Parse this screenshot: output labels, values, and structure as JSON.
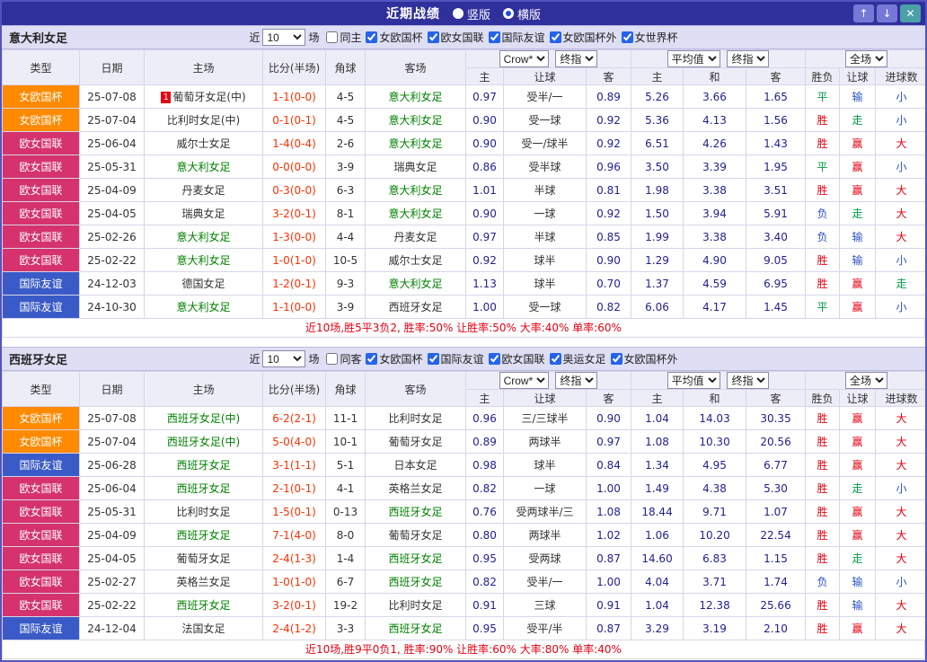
{
  "topbar": {
    "title": "近期战绩",
    "opt_vertical": "竖版",
    "opt_horizontal": "横版",
    "icons": {
      "up": "↑",
      "down": "↓",
      "close": "✕"
    }
  },
  "filter": {
    "prefix": "近",
    "value": "10",
    "suffix": "场"
  },
  "header": {
    "type": "类型",
    "date": "日期",
    "home": "主场",
    "score": "比分(半场)",
    "corner": "角球",
    "away": "客场",
    "g1_select1": "Crow*",
    "g1_select2": "终指",
    "g2_select1": "平均值",
    "g2_select2": "终指",
    "g3_select": "全场",
    "sub1_home": "主",
    "sub1_hcap": "让球",
    "sub1_away": "客",
    "sub2_home": "主",
    "sub2_draw": "和",
    "sub2_away": "客",
    "sub3_wdl": "胜负",
    "sub3_hcap": "让球",
    "sub3_goals": "进球数"
  },
  "type_colors": {
    "女欧国杯": "#ff8a00",
    "欧女国联": "#d5326e",
    "国际友谊": "#3a5bc7"
  },
  "result_colors": {
    "胜": "#e60012",
    "赢": "#e60012",
    "大": "#e60012",
    "平": "#009944",
    "走": "#009944",
    "负": "#2a52be",
    "输": "#2a52be",
    "小": "#2a52be"
  },
  "sections": [
    {
      "team": "意大利女足",
      "filters": [
        {
          "label": "同主",
          "checked": false
        },
        {
          "label": "女欧国杯",
          "checked": true
        },
        {
          "label": "欧女国联",
          "checked": true
        },
        {
          "label": "国际友谊",
          "checked": true
        },
        {
          "label": "女欧国杯外",
          "checked": true
        },
        {
          "label": "女世界杯",
          "checked": true
        }
      ],
      "rows": [
        {
          "type": "女欧国杯",
          "date": "25-07-08",
          "home": "葡萄牙女足(中)",
          "home_focus": false,
          "home_mark": "1",
          "score": "1-1(0-0)",
          "corner": "4-5",
          "away": "意大利女足",
          "away_focus": true,
          "odds_home": "0.97",
          "handicap": "受半/一",
          "odds_away": "0.89",
          "avg_home": "5.26",
          "avg_draw": "3.66",
          "avg_away": "1.65",
          "wdl": "平",
          "hcap_result": "输",
          "goals_result": "小"
        },
        {
          "type": "女欧国杯",
          "date": "25-07-04",
          "home": "比利时女足(中)",
          "home_focus": false,
          "score": "0-1(0-1)",
          "corner": "4-5",
          "away": "意大利女足",
          "away_focus": true,
          "odds_home": "0.90",
          "handicap": "受一球",
          "odds_away": "0.92",
          "avg_home": "5.36",
          "avg_draw": "4.13",
          "avg_away": "1.56",
          "wdl": "胜",
          "hcap_result": "走",
          "goals_result": "小"
        },
        {
          "type": "欧女国联",
          "date": "25-06-04",
          "home": "威尔士女足",
          "home_focus": false,
          "score": "1-4(0-4)",
          "corner": "2-6",
          "away": "意大利女足",
          "away_focus": true,
          "odds_home": "0.90",
          "handicap": "受一/球半",
          "odds_away": "0.92",
          "avg_home": "6.51",
          "avg_draw": "4.26",
          "avg_away": "1.43",
          "wdl": "胜",
          "hcap_result": "赢",
          "goals_result": "大"
        },
        {
          "type": "欧女国联",
          "date": "25-05-31",
          "home": "意大利女足",
          "home_focus": true,
          "score": "0-0(0-0)",
          "corner": "3-9",
          "away": "瑞典女足",
          "away_focus": false,
          "odds_home": "0.86",
          "handicap": "受半球",
          "odds_away": "0.96",
          "avg_home": "3.50",
          "avg_draw": "3.39",
          "avg_away": "1.95",
          "wdl": "平",
          "hcap_result": "赢",
          "goals_result": "小"
        },
        {
          "type": "欧女国联",
          "date": "25-04-09",
          "home": "丹麦女足",
          "home_focus": false,
          "score": "0-3(0-0)",
          "corner": "6-3",
          "away": "意大利女足",
          "away_focus": true,
          "odds_home": "1.01",
          "handicap": "半球",
          "odds_away": "0.81",
          "avg_home": "1.98",
          "avg_draw": "3.38",
          "avg_away": "3.51",
          "wdl": "胜",
          "hcap_result": "赢",
          "goals_result": "大"
        },
        {
          "type": "欧女国联",
          "date": "25-04-05",
          "home": "瑞典女足",
          "home_focus": false,
          "score": "3-2(0-1)",
          "corner": "8-1",
          "away": "意大利女足",
          "away_focus": true,
          "odds_home": "0.90",
          "handicap": "一球",
          "odds_away": "0.92",
          "avg_home": "1.50",
          "avg_draw": "3.94",
          "avg_away": "5.91",
          "wdl": "负",
          "hcap_result": "走",
          "goals_result": "大"
        },
        {
          "type": "欧女国联",
          "date": "25-02-26",
          "home": "意大利女足",
          "home_focus": true,
          "score": "1-3(0-0)",
          "corner": "4-4",
          "away": "丹麦女足",
          "away_focus": false,
          "odds_home": "0.97",
          "handicap": "半球",
          "odds_away": "0.85",
          "avg_home": "1.99",
          "avg_draw": "3.38",
          "avg_away": "3.40",
          "wdl": "负",
          "hcap_result": "输",
          "goals_result": "大"
        },
        {
          "type": "欧女国联",
          "date": "25-02-22",
          "home": "意大利女足",
          "home_focus": true,
          "score": "1-0(1-0)",
          "corner": "10-5",
          "away": "威尔士女足",
          "away_focus": false,
          "odds_home": "0.92",
          "handicap": "球半",
          "odds_away": "0.90",
          "avg_home": "1.29",
          "avg_draw": "4.90",
          "avg_away": "9.05",
          "wdl": "胜",
          "hcap_result": "输",
          "goals_result": "小"
        },
        {
          "type": "国际友谊",
          "date": "24-12-03",
          "home": "德国女足",
          "home_focus": false,
          "score": "1-2(0-1)",
          "corner": "9-3",
          "away": "意大利女足",
          "away_focus": true,
          "odds_home": "1.13",
          "handicap": "球半",
          "odds_away": "0.70",
          "avg_home": "1.37",
          "avg_draw": "4.59",
          "avg_away": "6.95",
          "wdl": "胜",
          "hcap_result": "赢",
          "goals_result": "走"
        },
        {
          "type": "国际友谊",
          "date": "24-10-30",
          "home": "意大利女足",
          "home_focus": true,
          "score": "1-1(0-0)",
          "corner": "3-9",
          "away": "西班牙女足",
          "away_focus": false,
          "odds_home": "1.00",
          "handicap": "受一球",
          "odds_away": "0.82",
          "avg_home": "6.06",
          "avg_draw": "4.17",
          "avg_away": "1.45",
          "wdl": "平",
          "hcap_result": "赢",
          "goals_result": "小"
        }
      ],
      "summary": "近10场,胜5平3负2, 胜率:50% 让胜率:50% 大率:40% 单率:60%"
    },
    {
      "team": "西班牙女足",
      "filters": [
        {
          "label": "同客",
          "checked": false
        },
        {
          "label": "女欧国杯",
          "checked": true
        },
        {
          "label": "国际友谊",
          "checked": true
        },
        {
          "label": "欧女国联",
          "checked": true
        },
        {
          "label": "奥运女足",
          "checked": true
        },
        {
          "label": "女欧国杯外",
          "checked": true
        }
      ],
      "rows": [
        {
          "type": "女欧国杯",
          "date": "25-07-08",
          "home": "西班牙女足(中)",
          "home_focus": true,
          "score": "6-2(2-1)",
          "corner": "11-1",
          "away": "比利时女足",
          "away_focus": false,
          "odds_home": "0.96",
          "handicap": "三/三球半",
          "odds_away": "0.90",
          "avg_home": "1.04",
          "avg_draw": "14.03",
          "avg_away": "30.35",
          "wdl": "胜",
          "hcap_result": "赢",
          "goals_result": "大"
        },
        {
          "type": "女欧国杯",
          "date": "25-07-04",
          "home": "西班牙女足(中)",
          "home_focus": true,
          "score": "5-0(4-0)",
          "corner": "10-1",
          "away": "葡萄牙女足",
          "away_focus": false,
          "odds_home": "0.89",
          "handicap": "两球半",
          "odds_away": "0.97",
          "avg_home": "1.08",
          "avg_draw": "10.30",
          "avg_away": "20.56",
          "wdl": "胜",
          "hcap_result": "赢",
          "goals_result": "大"
        },
        {
          "type": "国际友谊",
          "date": "25-06-28",
          "home": "西班牙女足",
          "home_focus": true,
          "score": "3-1(1-1)",
          "corner": "5-1",
          "away": "日本女足",
          "away_focus": false,
          "odds_home": "0.98",
          "handicap": "球半",
          "odds_away": "0.84",
          "avg_home": "1.34",
          "avg_draw": "4.95",
          "avg_away": "6.77",
          "wdl": "胜",
          "hcap_result": "赢",
          "goals_result": "大"
        },
        {
          "type": "欧女国联",
          "date": "25-06-04",
          "home": "西班牙女足",
          "home_focus": true,
          "score": "2-1(0-1)",
          "corner": "4-1",
          "away": "英格兰女足",
          "away_focus": false,
          "odds_home": "0.82",
          "handicap": "一球",
          "odds_away": "1.00",
          "avg_home": "1.49",
          "avg_draw": "4.38",
          "avg_away": "5.30",
          "wdl": "胜",
          "hcap_result": "走",
          "goals_result": "小"
        },
        {
          "type": "欧女国联",
          "date": "25-05-31",
          "home": "比利时女足",
          "home_focus": false,
          "score": "1-5(0-1)",
          "corner": "0-13",
          "away": "西班牙女足",
          "away_focus": true,
          "odds_home": "0.76",
          "handicap": "受两球半/三",
          "odds_away": "1.08",
          "avg_home": "18.44",
          "avg_draw": "9.71",
          "avg_away": "1.07",
          "wdl": "胜",
          "hcap_result": "赢",
          "goals_result": "大"
        },
        {
          "type": "欧女国联",
          "date": "25-04-09",
          "home": "西班牙女足",
          "home_focus": true,
          "score": "7-1(4-0)",
          "corner": "8-0",
          "away": "葡萄牙女足",
          "away_focus": false,
          "odds_home": "0.80",
          "handicap": "两球半",
          "odds_away": "1.02",
          "avg_home": "1.06",
          "avg_draw": "10.20",
          "avg_away": "22.54",
          "wdl": "胜",
          "hcap_result": "赢",
          "goals_result": "大"
        },
        {
          "type": "欧女国联",
          "date": "25-04-05",
          "home": "葡萄牙女足",
          "home_focus": false,
          "score": "2-4(1-3)",
          "corner": "1-4",
          "away": "西班牙女足",
          "away_focus": true,
          "odds_home": "0.95",
          "handicap": "受两球",
          "odds_away": "0.87",
          "avg_home": "14.60",
          "avg_draw": "6.83",
          "avg_away": "1.15",
          "wdl": "胜",
          "hcap_result": "走",
          "goals_result": "大"
        },
        {
          "type": "欧女国联",
          "date": "25-02-27",
          "home": "英格兰女足",
          "home_focus": false,
          "score": "1-0(1-0)",
          "corner": "6-7",
          "away": "西班牙女足",
          "away_focus": true,
          "odds_home": "0.82",
          "handicap": "受半/一",
          "odds_away": "1.00",
          "avg_home": "4.04",
          "avg_draw": "3.71",
          "avg_away": "1.74",
          "wdl": "负",
          "hcap_result": "输",
          "goals_result": "小"
        },
        {
          "type": "欧女国联",
          "date": "25-02-22",
          "home": "西班牙女足",
          "home_focus": true,
          "score": "3-2(0-1)",
          "corner": "19-2",
          "away": "比利时女足",
          "away_focus": false,
          "odds_home": "0.91",
          "handicap": "三球",
          "odds_away": "0.91",
          "avg_home": "1.04",
          "avg_draw": "12.38",
          "avg_away": "25.66",
          "wdl": "胜",
          "hcap_result": "输",
          "goals_result": "大"
        },
        {
          "type": "国际友谊",
          "date": "24-12-04",
          "home": "法国女足",
          "home_focus": false,
          "score": "2-4(1-2)",
          "corner": "3-3",
          "away": "西班牙女足",
          "away_focus": true,
          "odds_home": "0.95",
          "handicap": "受平/半",
          "odds_away": "0.87",
          "avg_home": "3.29",
          "avg_draw": "3.19",
          "avg_away": "2.10",
          "wdl": "胜",
          "hcap_result": "赢",
          "goals_result": "大"
        }
      ],
      "summary": "近10场,胜9平0负1, 胜率:90% 让胜率:60% 大率:80% 单率:40%"
    }
  ]
}
